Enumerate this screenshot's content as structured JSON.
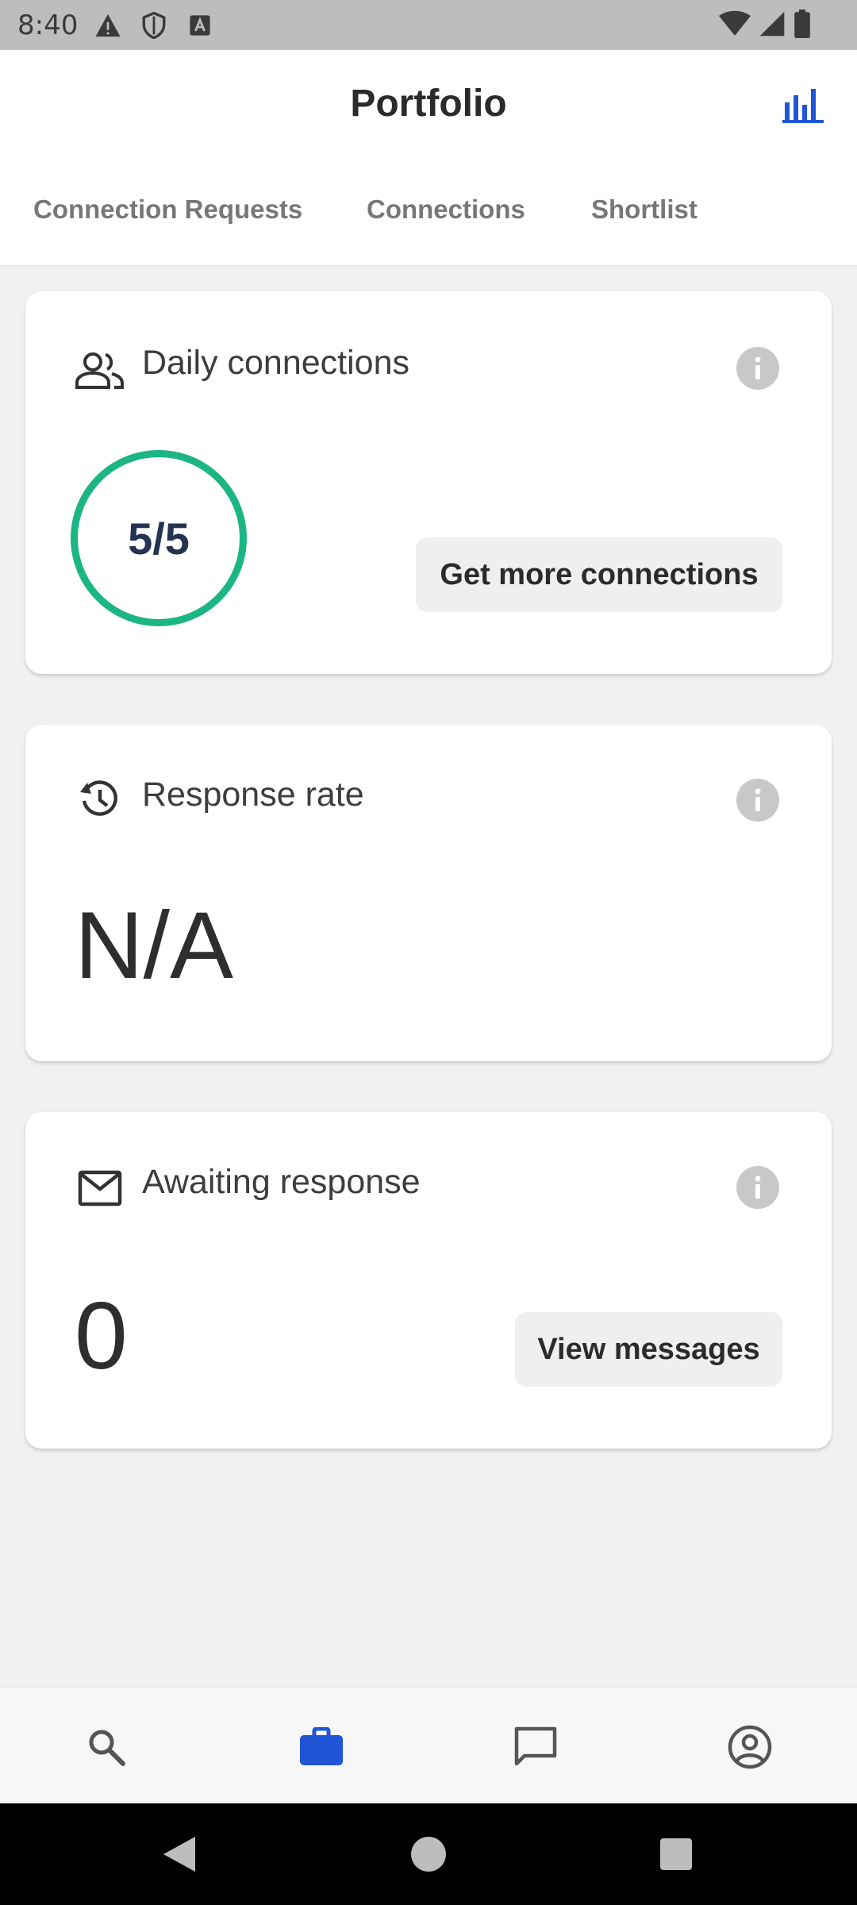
{
  "status_bar": {
    "time": "8:40",
    "left_icons": [
      "alert-icon",
      "shield-icon",
      "a-badge-icon"
    ],
    "right_icons": [
      "wifi-icon",
      "signal-icon",
      "battery-icon"
    ]
  },
  "app_bar": {
    "title": "Portfolio",
    "action_icon": "bar-chart-icon",
    "accent": "#1f55d6"
  },
  "tabs": [
    {
      "label": "Connection Requests"
    },
    {
      "label": "Connections"
    },
    {
      "label": "Shortlist"
    }
  ],
  "cards": {
    "daily": {
      "icon": "people-icon",
      "title": "Daily connections",
      "ring_value": "5/5",
      "ring_color": "#1cb584",
      "button_label": "Get more connections"
    },
    "response": {
      "icon": "history-icon",
      "title": "Response rate",
      "value": "N/A"
    },
    "awaiting": {
      "icon": "mail-icon",
      "title": "Awaiting response",
      "value": "0",
      "button_label": "View messages"
    }
  },
  "bottom_nav": {
    "items": [
      {
        "icon": "search-icon",
        "active": false
      },
      {
        "icon": "briefcase-icon",
        "active": true
      },
      {
        "icon": "chat-icon",
        "active": false
      },
      {
        "icon": "account-icon",
        "active": false
      }
    ],
    "active_color": "#1f55d6"
  },
  "system_nav": [
    "back-icon",
    "home-icon",
    "recents-icon"
  ]
}
